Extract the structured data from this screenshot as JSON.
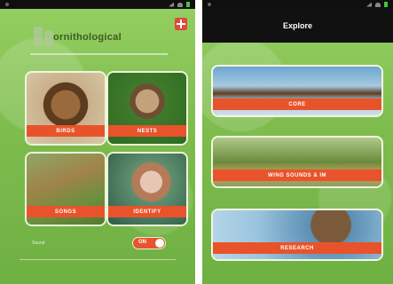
{
  "left_screen": {
    "title": "ornithological",
    "tiles": [
      {
        "label": "BIRDS"
      },
      {
        "label": "NESTS"
      },
      {
        "label": "SONGS"
      },
      {
        "label": "IDENTIFY"
      }
    ],
    "toggle": {
      "label": "Sound",
      "state": "ON"
    }
  },
  "right_screen": {
    "header_title": "Explore",
    "cards": [
      {
        "label": "CORE"
      },
      {
        "label": "WING SOUNDS & IM"
      },
      {
        "label": "RESEARCH"
      }
    ]
  },
  "colors": {
    "grass_green": "#7fbe4f",
    "label_orange": "#e9532b",
    "status_bar": "#0f0f0f",
    "help_red": "#e04b3a"
  }
}
